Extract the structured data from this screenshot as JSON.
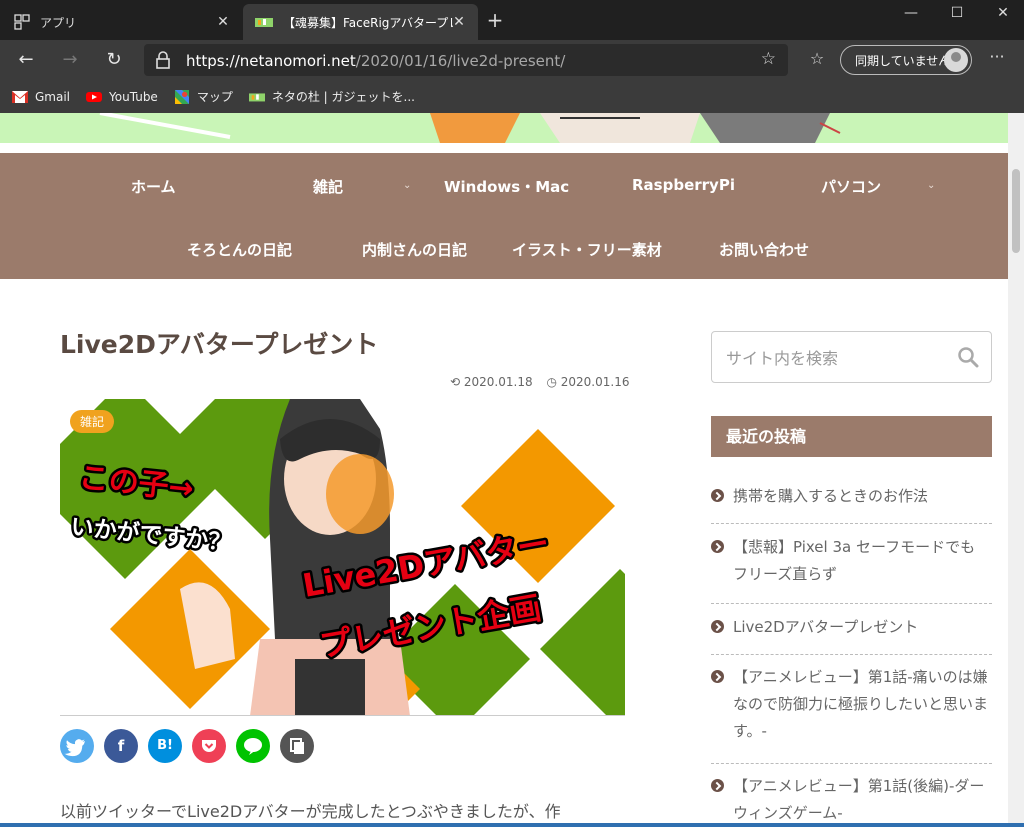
{
  "browser": {
    "tabs": [
      {
        "title": "アプリ",
        "active": false
      },
      {
        "title": "【魂募集】FaceRigアバタープレゼント",
        "active": true
      }
    ],
    "window_controls": {
      "minimize": "—",
      "maximize": "☐",
      "close": "✕"
    },
    "address": {
      "host": "https://netanomori.net",
      "path": "/2020/01/16/live2d-present/"
    },
    "sync_label": "同期していません",
    "bookmarks": [
      {
        "label": "Gmail",
        "icon": "gmail-icon"
      },
      {
        "label": "YouTube",
        "icon": "youtube-icon"
      },
      {
        "label": "マップ",
        "icon": "maps-icon"
      },
      {
        "label": "ネタの杜 | ガジェットを...",
        "icon": "site-icon"
      }
    ]
  },
  "nav": {
    "row1": [
      "ホーム",
      "雑記",
      "Windows・Mac",
      "RaspberryPi",
      "パソコン"
    ],
    "row2": [
      "そろとんの日記",
      "内制さんの日記",
      "イラスト・フリー素材",
      "お問い合わせ"
    ]
  },
  "article": {
    "title": "Live2Dアバタープレゼント",
    "updated": "2020.01.18",
    "published": "2020.01.16",
    "category": "雑記",
    "hero_text": {
      "line1": "この子→",
      "line2": "いかがですか？",
      "line3": "Live2Dアバター",
      "line4": "プレゼント企画"
    },
    "share_labels": {
      "facebook": "f",
      "hatena": "B!"
    },
    "body_start": "以前ツイッターでLive2Dアバターが完成したとつぶやきましたが、作"
  },
  "sidebar": {
    "search_placeholder": "サイト内を検索",
    "recent_title": "最近の投稿",
    "recent_posts": [
      "携帯を購入するときのお作法",
      "【悲報】Pixel 3a セーフモードでもフリーズ直らず",
      "Live2Dアバタープレゼント",
      "【アニメレビュー】第1話-痛いのは嫌なので防御力に極振りしたいと思います。-",
      "【アニメレビュー】第1話(後編)-ダーウィンズゲーム-"
    ]
  },
  "colors": {
    "nav_bg": "#9b7b6b",
    "badge": "#f0a21e",
    "twitter": "#55acee",
    "facebook": "#3b5998",
    "hatena": "#008fde",
    "pocket": "#ef4056",
    "line": "#00c300",
    "copy": "#555555"
  }
}
